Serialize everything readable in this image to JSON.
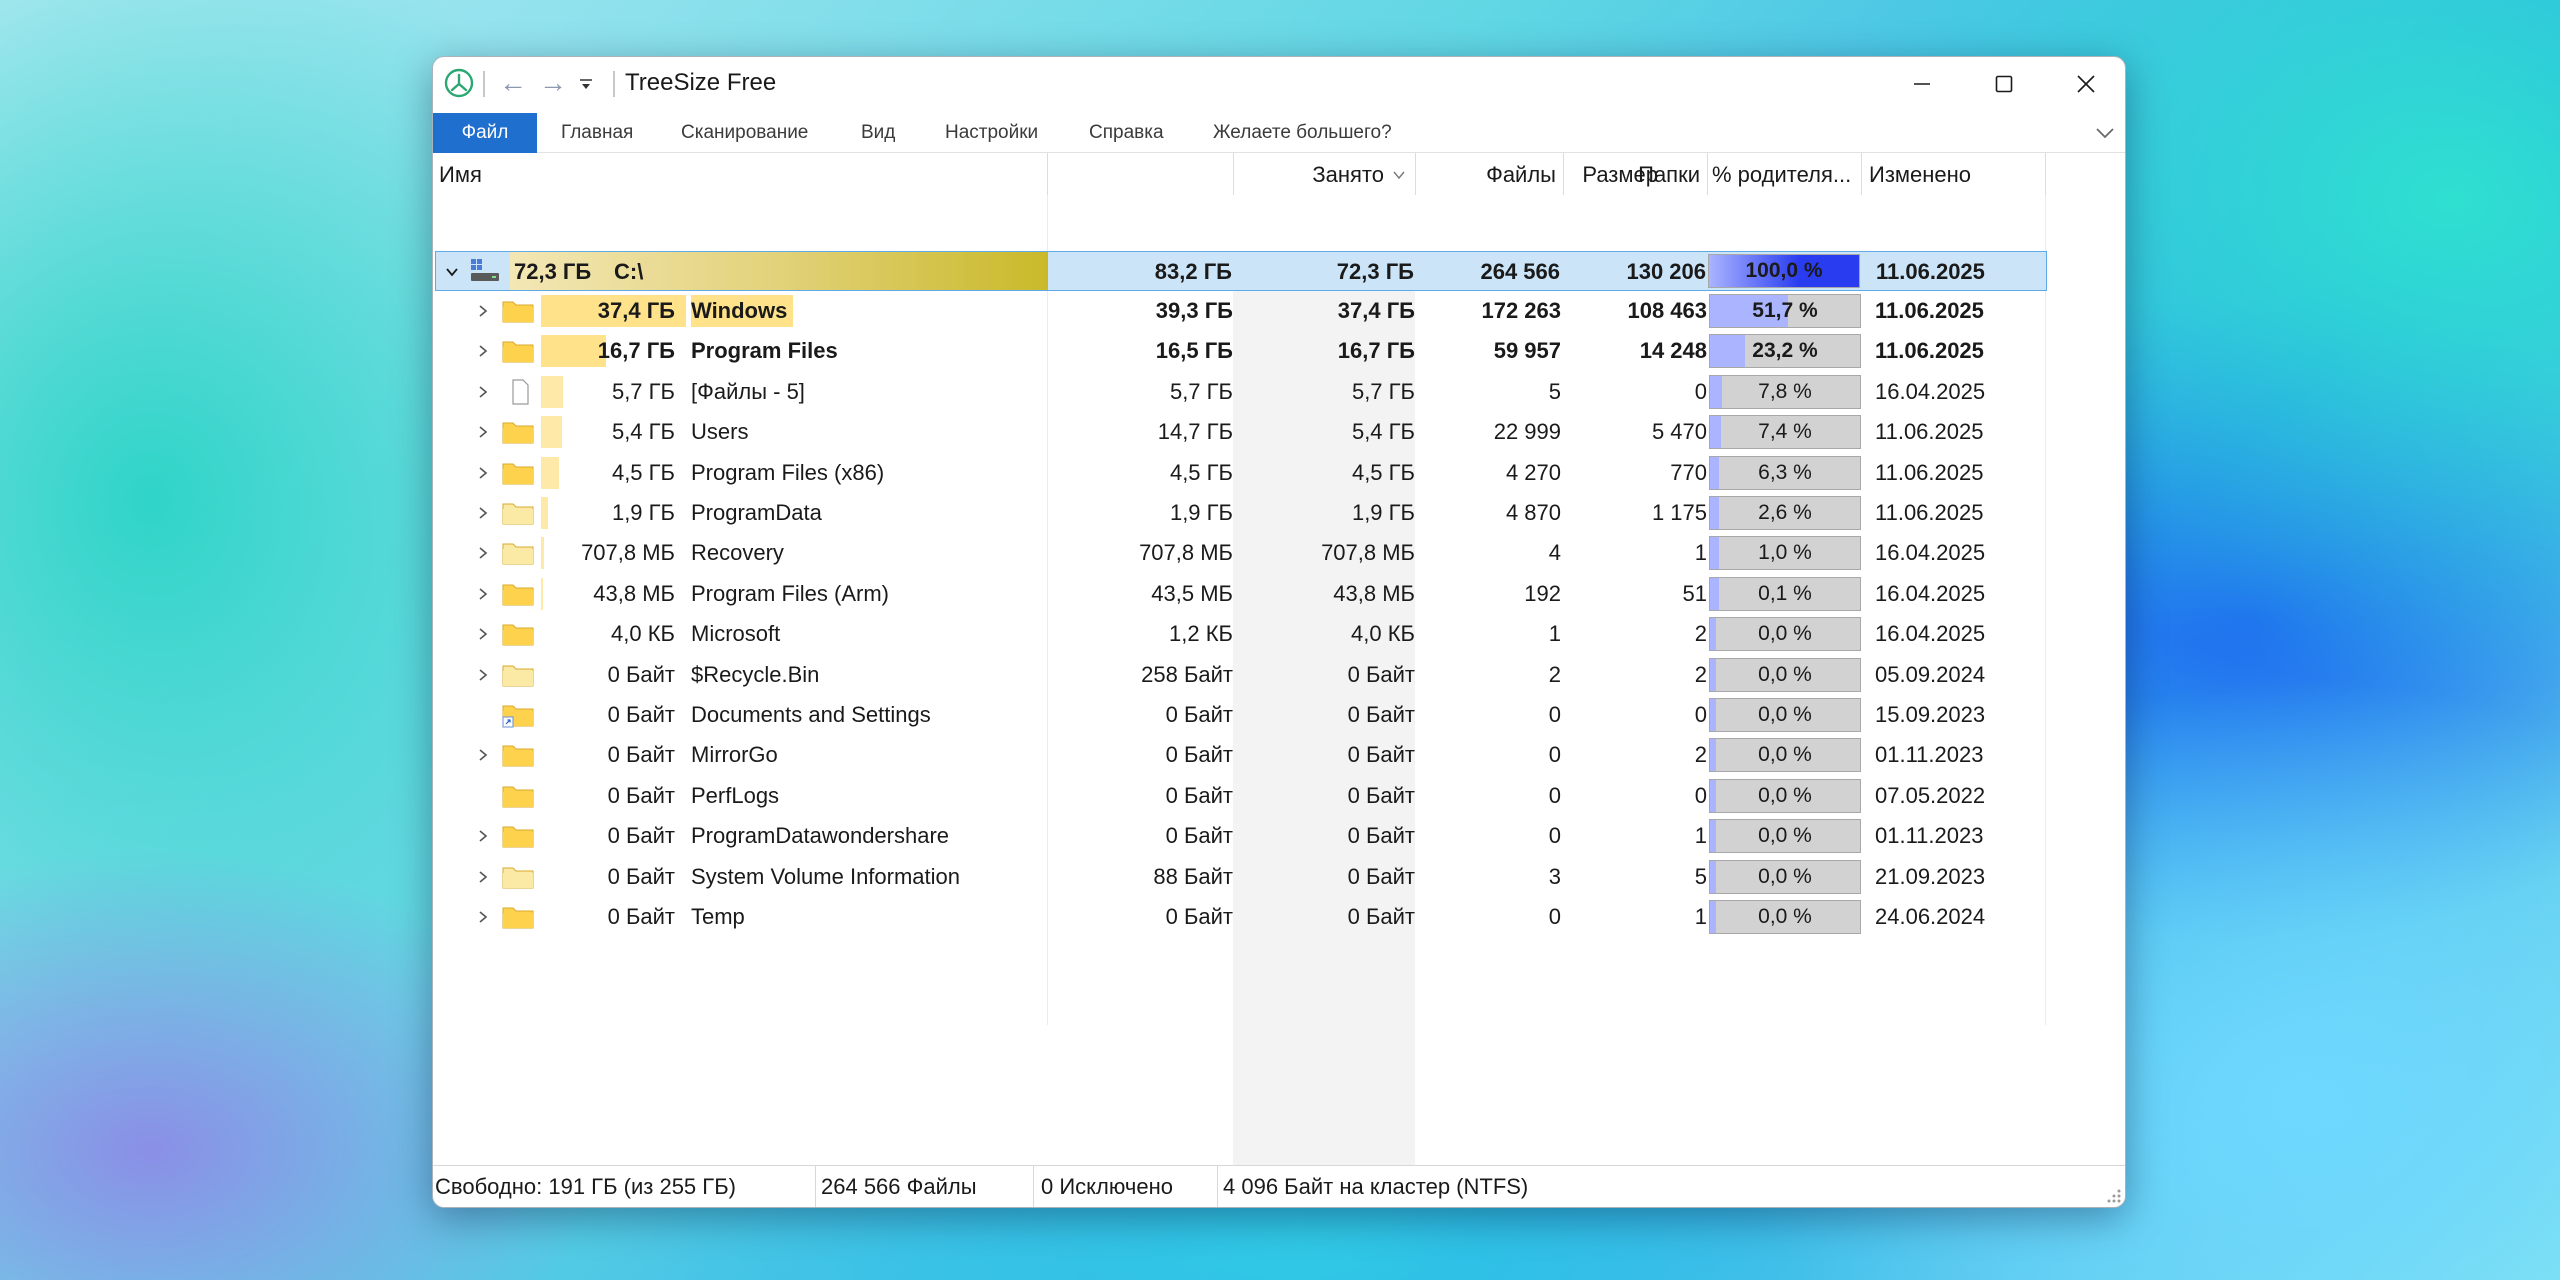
{
  "window": {
    "title": "TreeSize Free"
  },
  "ribbon": {
    "tabs": [
      {
        "label": "Файл",
        "active": true
      },
      {
        "label": "Главная"
      },
      {
        "label": "Сканирование"
      },
      {
        "label": "Вид"
      },
      {
        "label": "Настройки"
      },
      {
        "label": "Справка"
      },
      {
        "label": "Желаете большего?"
      }
    ]
  },
  "grid": {
    "columns": {
      "name": "Имя",
      "size": "Размер",
      "alloc": "Занято",
      "files": "Файлы",
      "folders": "Папки",
      "pct": "% родителя...",
      "modified": "Изменено"
    },
    "root": {
      "size_label": "72,3 ГБ",
      "name": "C:\\",
      "size": "83,2 ГБ",
      "alloc": "72,3 ГБ",
      "files": "264 566",
      "folders": "130 206",
      "pct": "100,0 %",
      "pct_value": 100.0,
      "modified": "11.06.2025"
    },
    "rows": [
      {
        "size_label": "37,4 ГБ",
        "name": "Windows",
        "size": "39,3 ГБ",
        "alloc": "37,4 ГБ",
        "files": "172 263",
        "folders": "108 463",
        "pct": "51,7 %",
        "pct_value": 51.7,
        "modified": "11.06.2025",
        "bold": true,
        "icon": "folder-icon",
        "expandable": true
      },
      {
        "size_label": "16,7 ГБ",
        "name": "Program Files",
        "size": "16,5 ГБ",
        "alloc": "16,7 ГБ",
        "files": "59 957",
        "folders": "14 248",
        "pct": "23,2 %",
        "pct_value": 23.2,
        "modified": "11.06.2025",
        "bold": true,
        "icon": "folder-icon",
        "expandable": true
      },
      {
        "size_label": "5,7 ГБ",
        "name": "[Файлы - 5]",
        "size": "5,7 ГБ",
        "alloc": "5,7 ГБ",
        "files": "5",
        "folders": "0",
        "pct": "7,8 %",
        "pct_value": 7.8,
        "modified": "16.04.2025",
        "bold": false,
        "icon": "file-icon",
        "expandable": true
      },
      {
        "size_label": "5,4 ГБ",
        "name": "Users",
        "size": "14,7 ГБ",
        "alloc": "5,4 ГБ",
        "files": "22 999",
        "folders": "5 470",
        "pct": "7,4 %",
        "pct_value": 7.4,
        "modified": "11.06.2025",
        "bold": false,
        "icon": "folder-icon",
        "expandable": true
      },
      {
        "size_label": "4,5 ГБ",
        "name": "Program Files (x86)",
        "size": "4,5 ГБ",
        "alloc": "4,5 ГБ",
        "files": "4 270",
        "folders": "770",
        "pct": "6,3 %",
        "pct_value": 6.3,
        "modified": "11.06.2025",
        "bold": false,
        "icon": "folder-icon",
        "expandable": true
      },
      {
        "size_label": "1,9 ГБ",
        "name": "ProgramData",
        "size": "1,9 ГБ",
        "alloc": "1,9 ГБ",
        "files": "4 870",
        "folders": "1 175",
        "pct": "2,6 %",
        "pct_value": 2.6,
        "modified": "11.06.2025",
        "bold": false,
        "icon": "folder-hidden-icon",
        "expandable": true
      },
      {
        "size_label": "707,8 МБ",
        "name": "Recovery",
        "size": "707,8 МБ",
        "alloc": "707,8 МБ",
        "files": "4",
        "folders": "1",
        "pct": "1,0 %",
        "pct_value": 1.0,
        "modified": "16.04.2025",
        "bold": false,
        "icon": "folder-hidden-icon",
        "expandable": true
      },
      {
        "size_label": "43,8 МБ",
        "name": "Program Files (Arm)",
        "size": "43,5 МБ",
        "alloc": "43,8 МБ",
        "files": "192",
        "folders": "51",
        "pct": "0,1 %",
        "pct_value": 0.1,
        "modified": "16.04.2025",
        "bold": false,
        "icon": "folder-icon",
        "expandable": true
      },
      {
        "size_label": "4,0 КБ",
        "name": "Microsoft",
        "size": "1,2 КБ",
        "alloc": "4,0 КБ",
        "files": "1",
        "folders": "2",
        "pct": "0,0 %",
        "pct_value": 0.0,
        "modified": "16.04.2025",
        "bold": false,
        "icon": "folder-icon",
        "expandable": true
      },
      {
        "size_label": "0 Байт",
        "name": "$Recycle.Bin",
        "size": "258 Байт",
        "alloc": "0 Байт",
        "files": "2",
        "folders": "2",
        "pct": "0,0 %",
        "pct_value": 0.0,
        "modified": "05.09.2024",
        "bold": false,
        "icon": "folder-hidden-icon",
        "expandable": true
      },
      {
        "size_label": "0 Байт",
        "name": "Documents and Settings",
        "size": "0 Байт",
        "alloc": "0 Байт",
        "files": "0",
        "folders": "0",
        "pct": "0,0 %",
        "pct_value": 0.0,
        "modified": "15.09.2023",
        "bold": false,
        "icon": "folder-link-icon",
        "expandable": false
      },
      {
        "size_label": "0 Байт",
        "name": "MirrorGo",
        "size": "0 Байт",
        "alloc": "0 Байт",
        "files": "0",
        "folders": "2",
        "pct": "0,0 %",
        "pct_value": 0.0,
        "modified": "01.11.2023",
        "bold": false,
        "icon": "folder-icon",
        "expandable": true
      },
      {
        "size_label": "0 Байт",
        "name": "PerfLogs",
        "size": "0 Байт",
        "alloc": "0 Байт",
        "files": "0",
        "folders": "0",
        "pct": "0,0 %",
        "pct_value": 0.0,
        "modified": "07.05.2022",
        "bold": false,
        "icon": "folder-icon",
        "expandable": false
      },
      {
        "size_label": "0 Байт",
        "name": "ProgramDatawondershare",
        "size": "0 Байт",
        "alloc": "0 Байт",
        "files": "0",
        "folders": "1",
        "pct": "0,0 %",
        "pct_value": 0.0,
        "modified": "01.11.2023",
        "bold": false,
        "icon": "folder-icon",
        "expandable": true
      },
      {
        "size_label": "0 Байт",
        "name": "System Volume Information",
        "size": "88 Байт",
        "alloc": "0 Байт",
        "files": "3",
        "folders": "5",
        "pct": "0,0 %",
        "pct_value": 0.0,
        "modified": "21.09.2023",
        "bold": false,
        "icon": "folder-hidden-icon",
        "expandable": true
      },
      {
        "size_label": "0 Байт",
        "name": "Temp",
        "size": "0 Байт",
        "alloc": "0 Байт",
        "files": "0",
        "folders": "1",
        "pct": "0,0 %",
        "pct_value": 0.0,
        "modified": "24.06.2024",
        "bold": false,
        "icon": "folder-icon",
        "expandable": true
      }
    ]
  },
  "status": {
    "free": "Свободно: 191 ГБ  (из 255 ГБ)",
    "files": "264 566 Файлы",
    "excluded": "0 Исключено",
    "cluster": "4 096 Байт на кластер (NTFS)"
  },
  "colors": {
    "accent": "#1f6fcf",
    "selection": "#cce4f7",
    "pct_fill": "#aab4ff",
    "pct_fill_full": "#2a3cf0",
    "size_bar": "#ffe9a8",
    "folder": "#ffd24d"
  }
}
